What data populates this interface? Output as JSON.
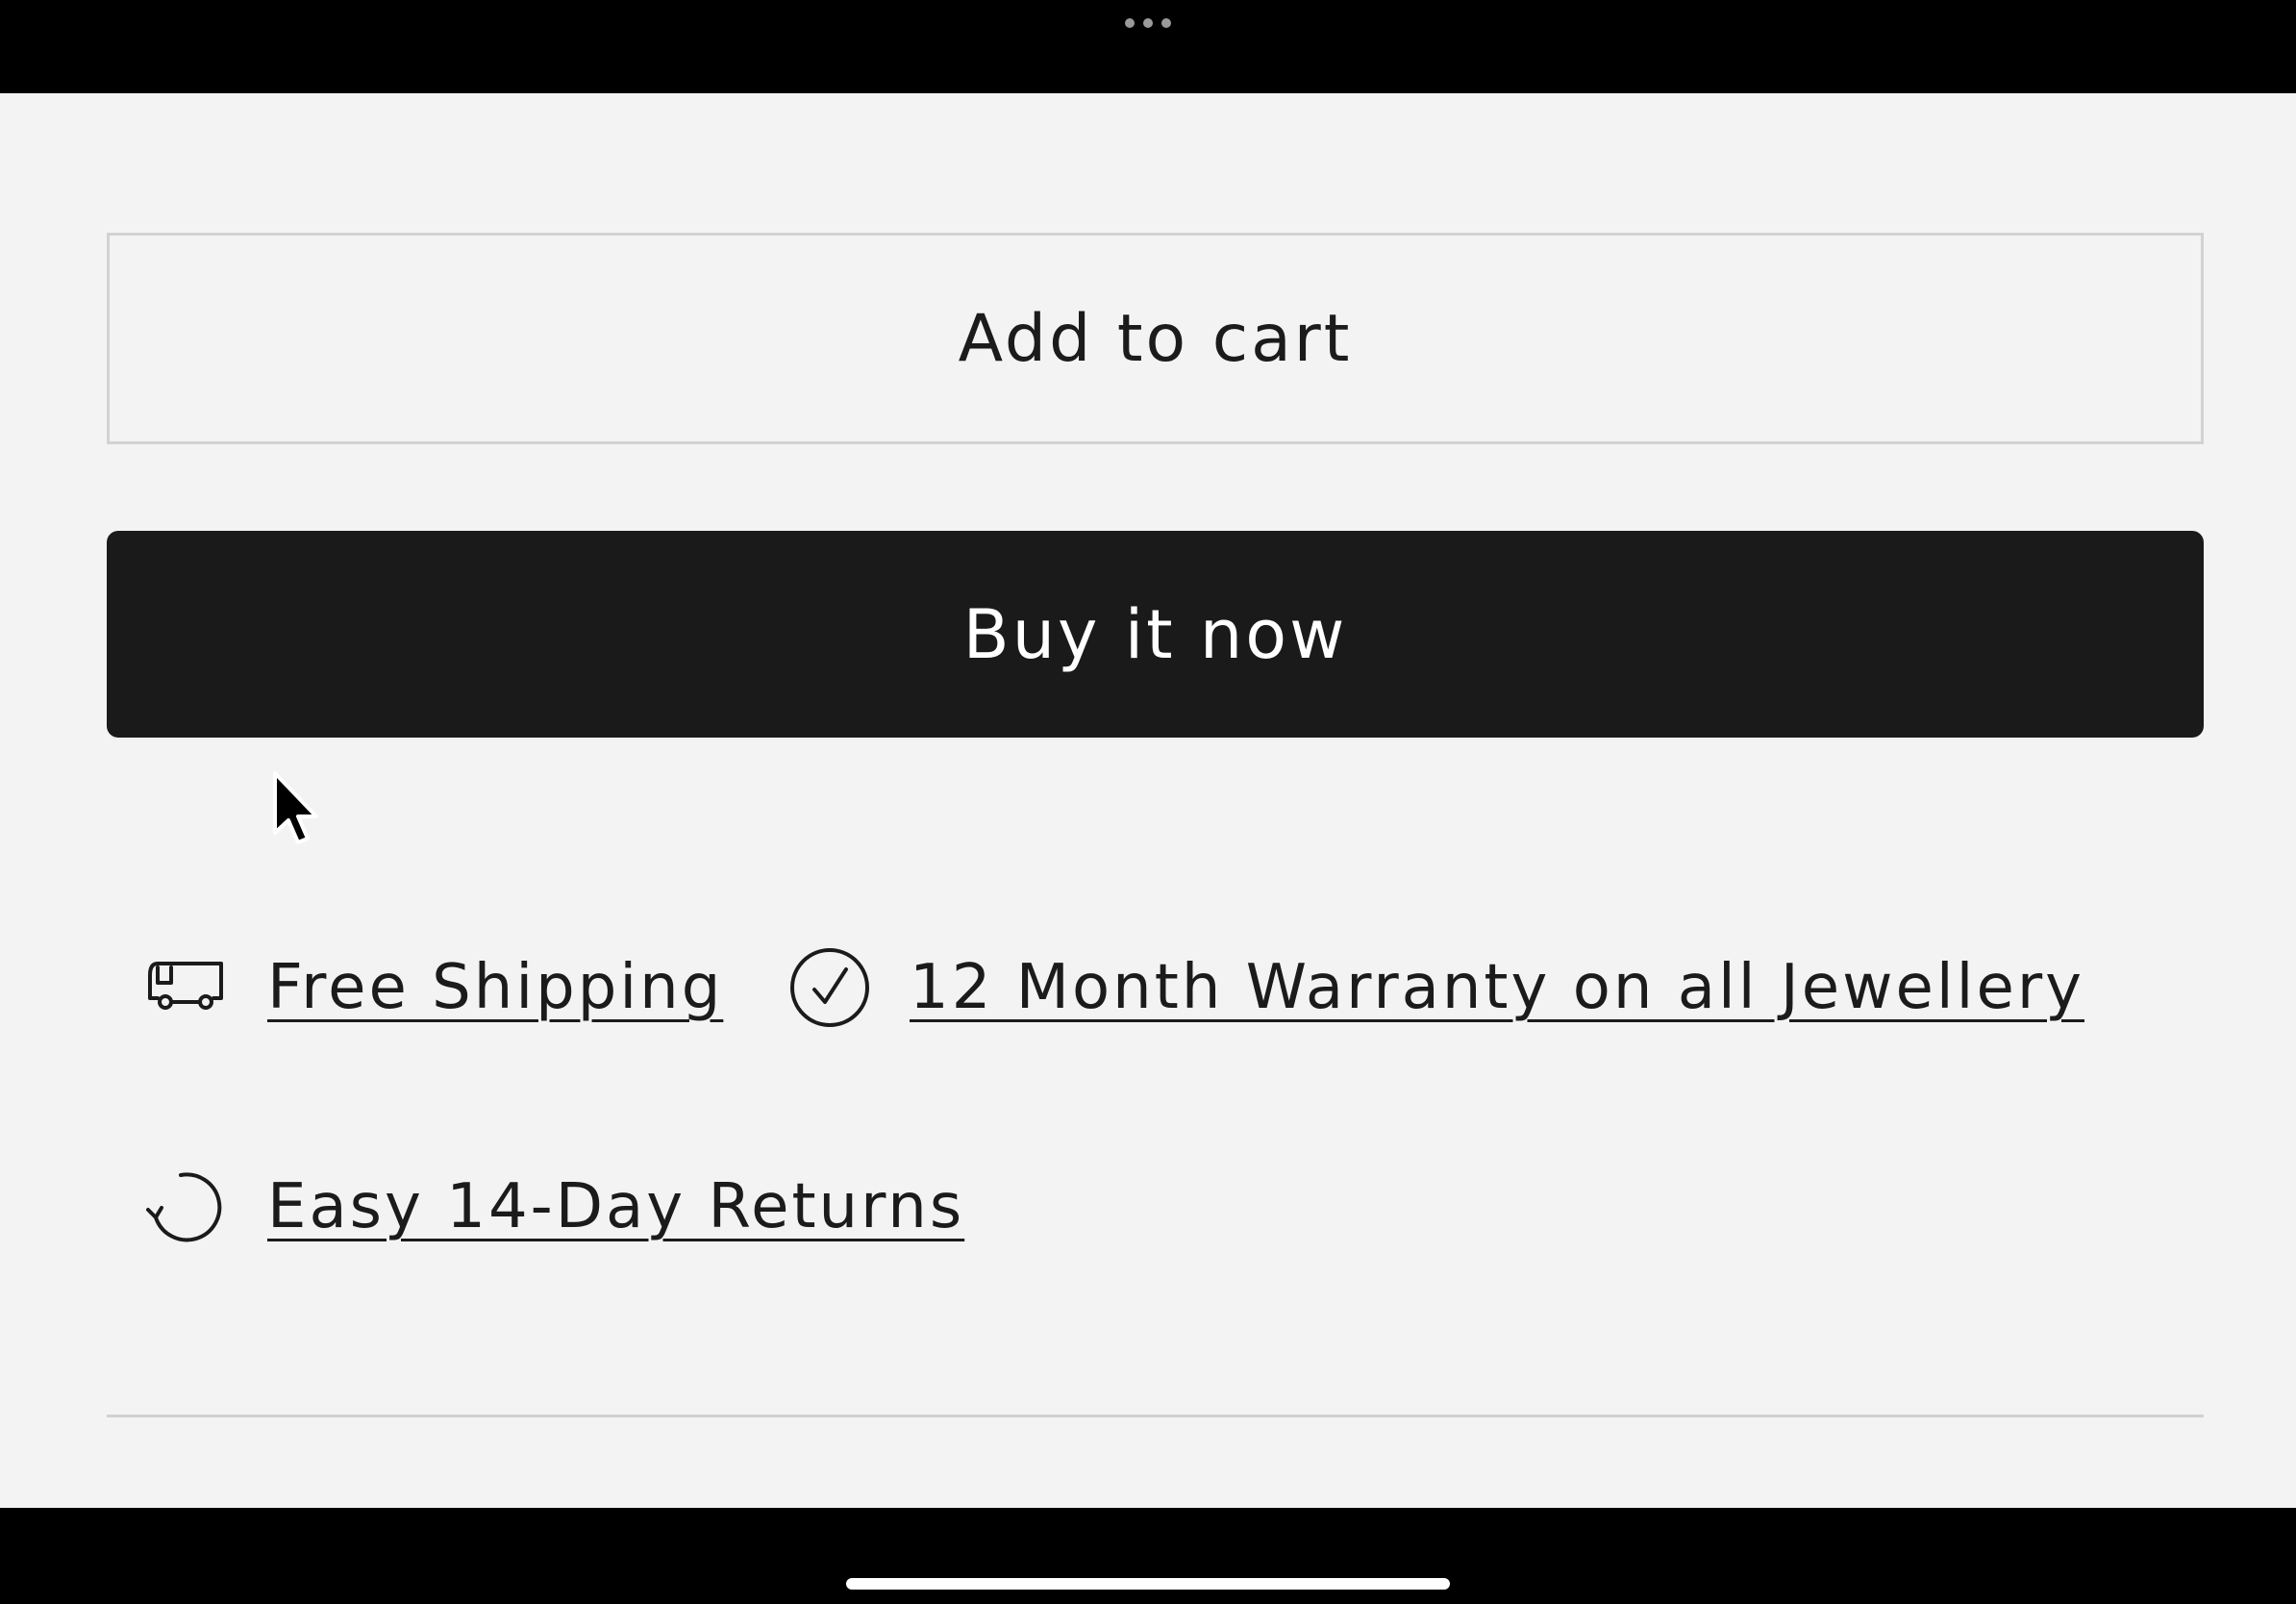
{
  "buttons": {
    "add_to_cart": "Add to cart",
    "buy_now": "Buy it now"
  },
  "features": [
    {
      "label": "Free Shipping",
      "icon": "delivery-truck-icon"
    },
    {
      "label": "12 Month Warranty on all Jewellery",
      "icon": "checkmark-circle-icon"
    },
    {
      "label": "Easy 14-Day Returns",
      "icon": "return-arrow-icon"
    }
  ],
  "colors": {
    "page_background": "#f3f3f3",
    "primary_button": "#1a1a1a",
    "primary_button_text": "#ffffff",
    "secondary_button_border": "#d2d2d2",
    "text": "#1b1b1b",
    "divider": "#d0d0d0"
  }
}
